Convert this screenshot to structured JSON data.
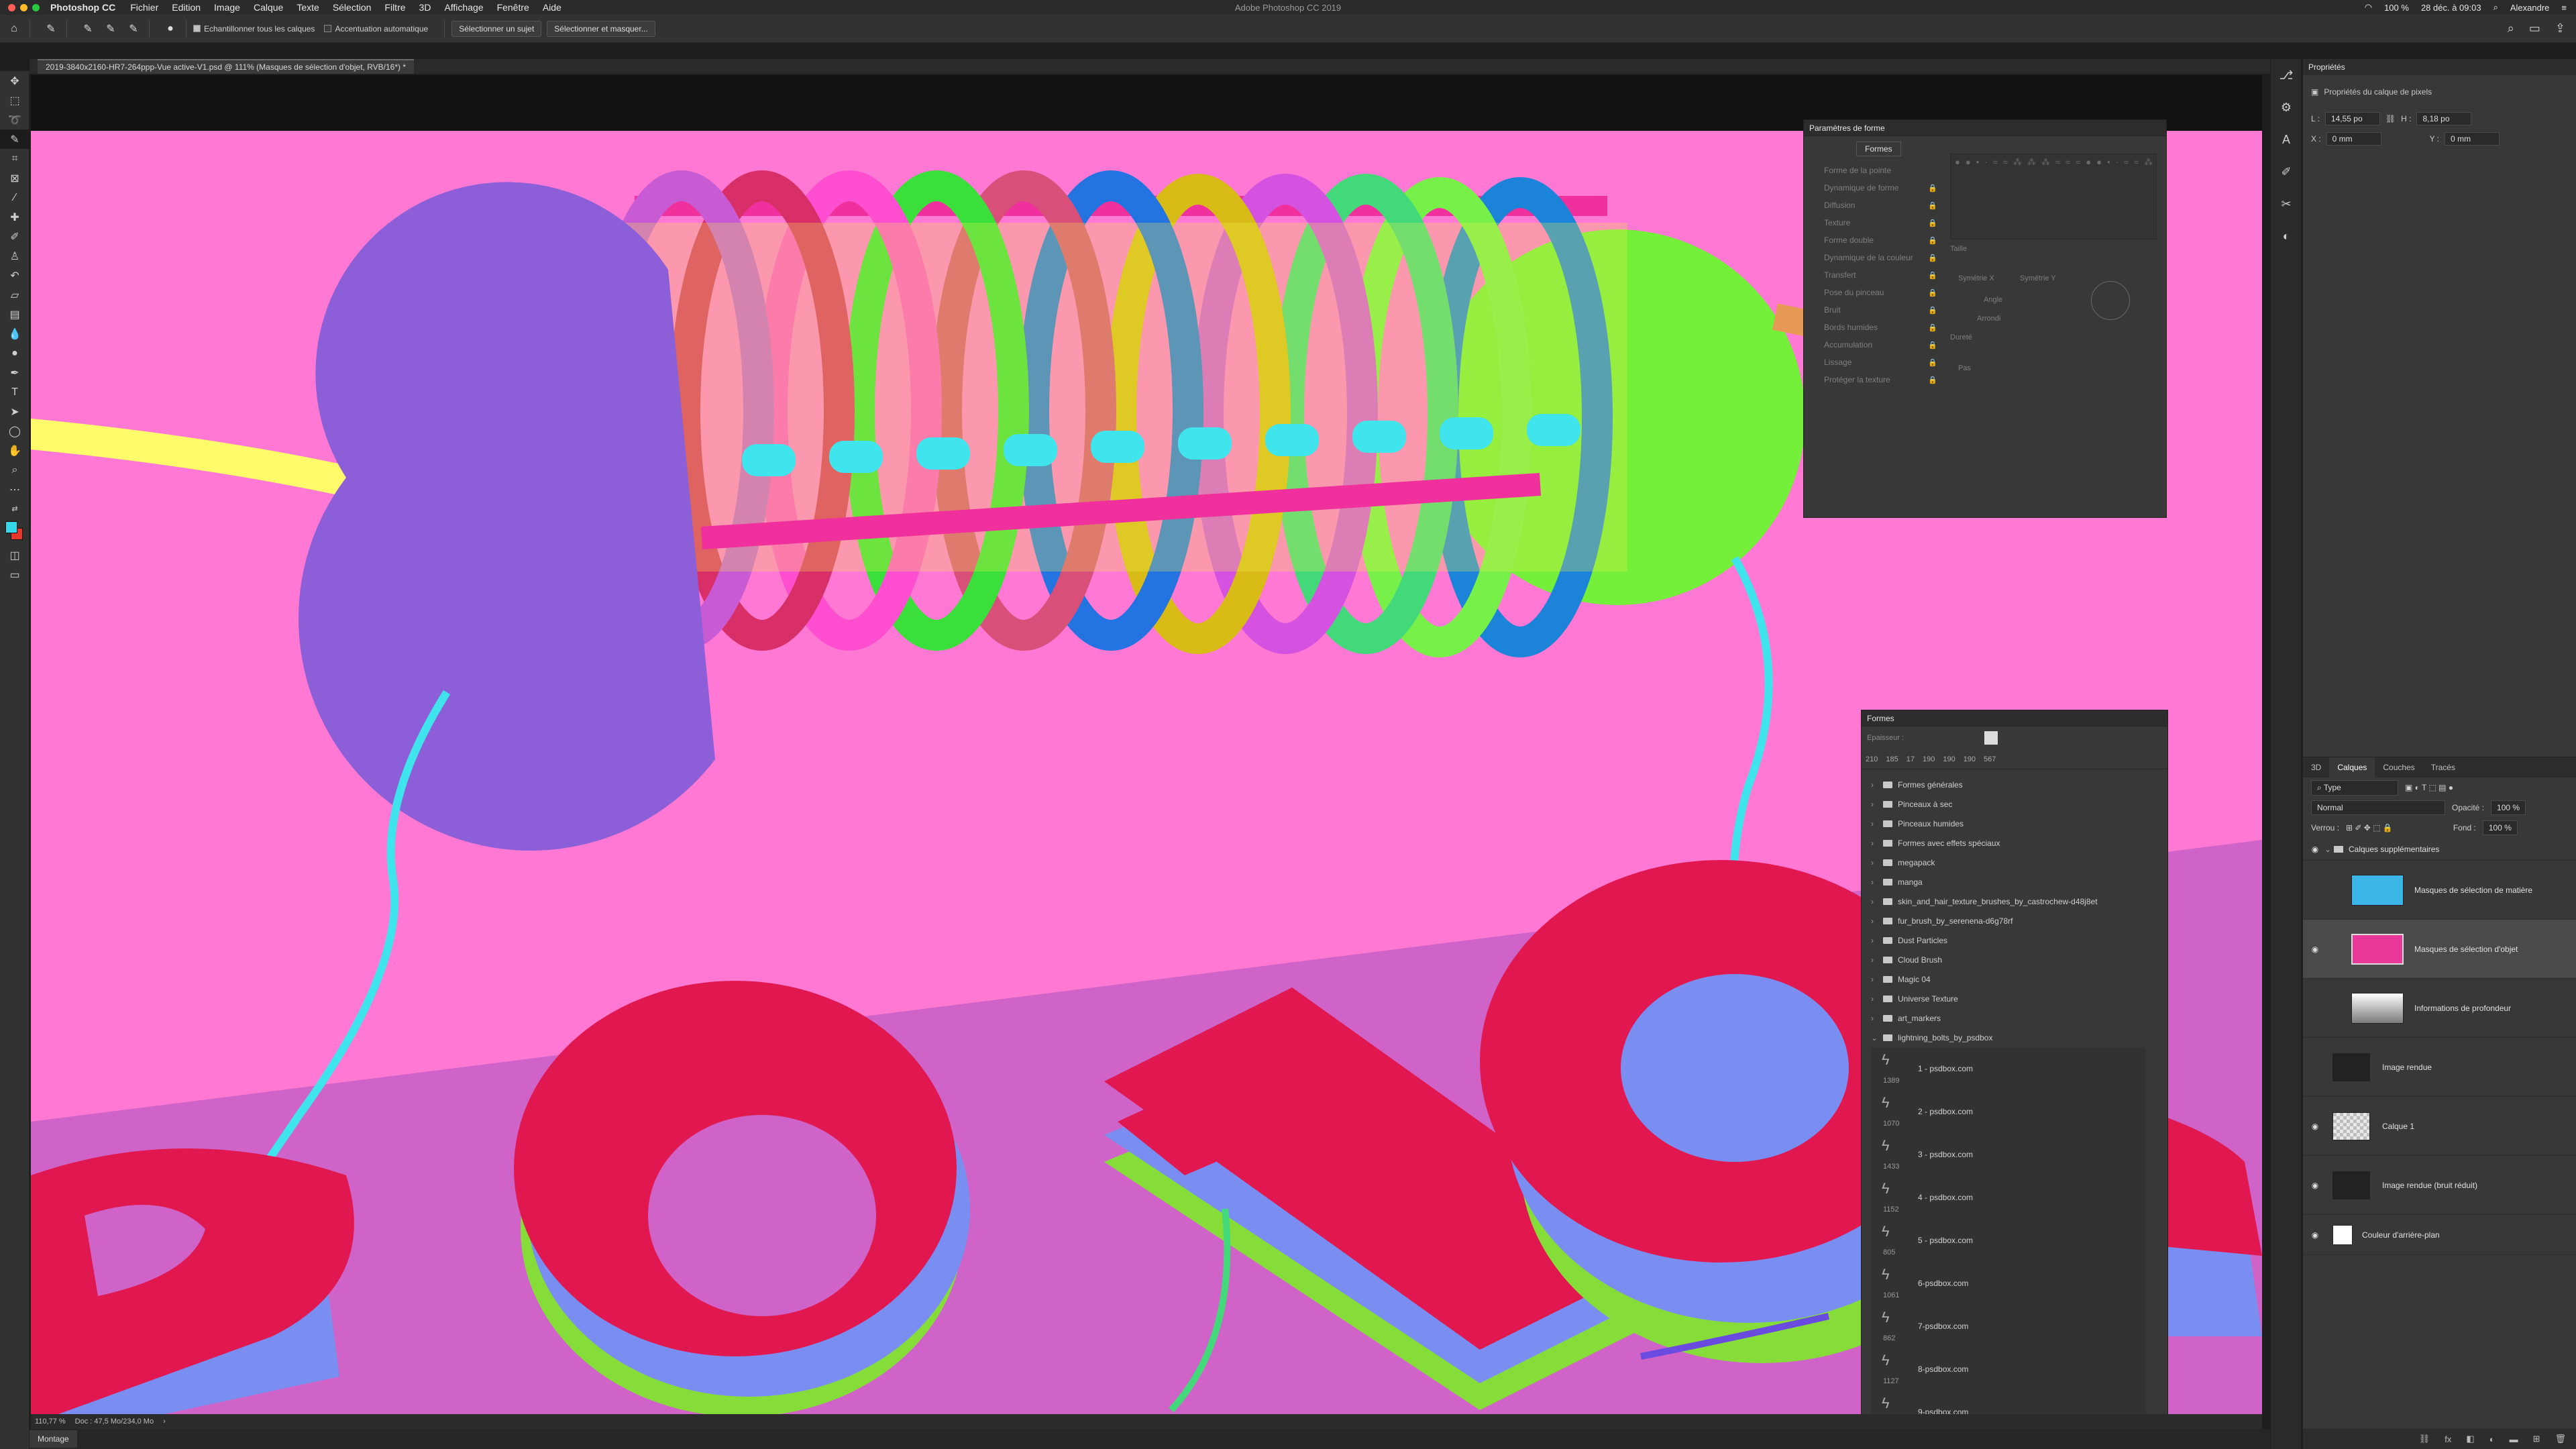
{
  "app": {
    "name": "Photoshop CC",
    "window_title": "Adobe Photoshop CC 2019"
  },
  "menu": [
    "Fichier",
    "Edition",
    "Image",
    "Calque",
    "Texte",
    "Sélection",
    "Filtre",
    "3D",
    "Affichage",
    "Fenêtre",
    "Aide"
  ],
  "status_right": {
    "battery": "100 %",
    "datetime": "28 déc. à 09:03",
    "user": "Alexandre"
  },
  "options_bar": {
    "sample_all": "Echantillonner tous les calques",
    "auto_enhance": "Accentuation automatique",
    "select_subject": "Sélectionner un sujet",
    "select_and_mask": "Sélectionner et masquer..."
  },
  "document": {
    "tab_title": "2019-3840x2160-HR7-264ppp-Vue active-V1.psd @ 111% (Masques de sélection d'objet, RVB/16*) *",
    "zoom": "110,77 %",
    "doc_info": "Doc : 47,5 Mo/234,0 Mo"
  },
  "bottom_tab": "Montage",
  "brush_settings": {
    "title": "Paramètres de forme",
    "tab": "Formes",
    "items": [
      "Forme de la pointe",
      "Dynamique de forme",
      "Diffusion",
      "Texture",
      "Forme double",
      "Dynamique de la couleur",
      "Transfert",
      "Pose du pinceau",
      "Bruit",
      "Bords humides",
      "Accumulation",
      "Lissage",
      "Protéger la texture"
    ],
    "labels": {
      "size": "Taille",
      "symmetry_x": "Symétrie X",
      "symmetry_y": "Symétrie Y",
      "angle": "Angle",
      "roundness": "Arrondi",
      "hardness": "Dureté",
      "spacing": "Pas"
    }
  },
  "brushes_panel": {
    "title": "Formes",
    "thickness_label": "Epaisseur :",
    "recent_sizes": [
      "210",
      "185",
      "17",
      "190",
      "190",
      "190",
      "567"
    ],
    "folders": [
      "Formes générales",
      "Pinceaux à sec",
      "Pinceaux humides",
      "Formes avec effets spéciaux",
      "megapack",
      "manga",
      "skin_and_hair_texture_brushes_by_castrochew-d48j8et",
      "fur_brush_by_serenena-d6g78rf",
      "Dust Particles",
      "Cloud Brush",
      "Magic 04",
      "Universe Texture",
      "art_markers",
      "lightning_bolts_by_psdbox"
    ],
    "brushes": [
      {
        "name": "1 - psdbox.com",
        "size": "1389"
      },
      {
        "name": "2 - psdbox.com",
        "size": "1070"
      },
      {
        "name": "3 - psdbox.com",
        "size": "1433"
      },
      {
        "name": "4 - psdbox.com",
        "size": "1152"
      },
      {
        "name": "5 - psdbox.com",
        "size": "805"
      },
      {
        "name": "6-psdbox.com",
        "size": "1061"
      },
      {
        "name": "7-psdbox.com",
        "size": "862"
      },
      {
        "name": "8-psdbox.com",
        "size": "1127"
      },
      {
        "name": "9-psdbox.com",
        "size": ""
      }
    ]
  },
  "properties": {
    "title": "Propriétés",
    "subtitle": "Propriétés du calque de pixels",
    "L": "14,55 po",
    "H": "8,18 po",
    "X": "0 mm",
    "Y": "0 mm"
  },
  "layers_panel": {
    "tabs": [
      "3D",
      "Calques",
      "Couches",
      "Tracés"
    ],
    "active_tab": "Calques",
    "filter": "Type",
    "blend_mode": "Normal",
    "opacity_label": "Opacité :",
    "opacity": "100 %",
    "lock_label": "Verrou :",
    "fill_label": "Fond :",
    "fill": "100 %",
    "layers": [
      {
        "name": "Calques supplémentaires",
        "type": "group",
        "visible": true
      },
      {
        "name": "Masques de sélection de matière",
        "visible": false,
        "selected": false,
        "thumb": "#3bb6e6"
      },
      {
        "name": "Masques de sélection d'objet",
        "visible": true,
        "selected": true,
        "thumb": "#e8389a"
      },
      {
        "name": "Informations de profondeur",
        "visible": false,
        "selected": false,
        "thumb": "#9a9a9a"
      },
      {
        "name": "Image rendue",
        "visible": false,
        "selected": false,
        "thumb": "#222222"
      },
      {
        "name": "Calque 1",
        "visible": true,
        "selected": false,
        "thumb": "#e8e8e8"
      },
      {
        "name": "Image rendue (bruit réduit)",
        "visible": true,
        "selected": false,
        "thumb": "#222222"
      },
      {
        "name": "Couleur d'arrière-plan",
        "visible": true,
        "selected": false,
        "thumb": "#ffffff"
      }
    ]
  },
  "colors": {
    "canvas_bg": "#ff78d3",
    "floor": "#cf63c8",
    "accent": "#e1184f",
    "fg_swatch": "#35d8e8",
    "bg_swatch": "#e8372a"
  },
  "icons": [
    "home-icon",
    "quick-selection-icon",
    "search-icon",
    "workspace-icon",
    "share-icon",
    "eye-icon",
    "lock-icon",
    "folder-icon"
  ]
}
